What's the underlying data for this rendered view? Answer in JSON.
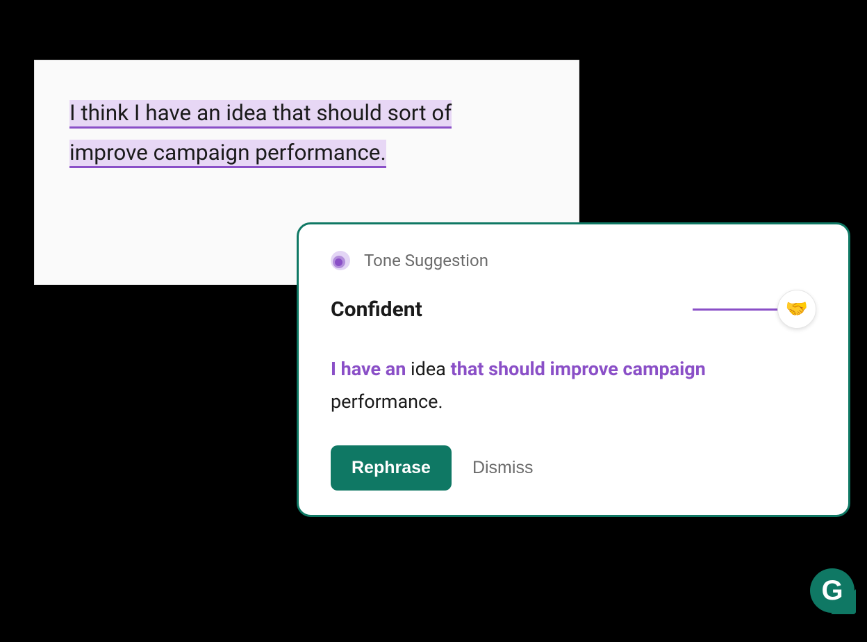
{
  "editor": {
    "line1": "I think I have an idea that should sort of",
    "line2": "improve campaign performance."
  },
  "suggestion": {
    "label": "Tone Suggestion",
    "tone_title": "Confident",
    "emoji": "🤝",
    "rewrite": {
      "seg1": "I have an",
      "seg2": " idea ",
      "seg3": "that should improve campaign",
      "seg4": " performance."
    },
    "actions": {
      "rephrase": "Rephrase",
      "dismiss": "Dismiss"
    }
  },
  "badge": {
    "letter": "G"
  }
}
